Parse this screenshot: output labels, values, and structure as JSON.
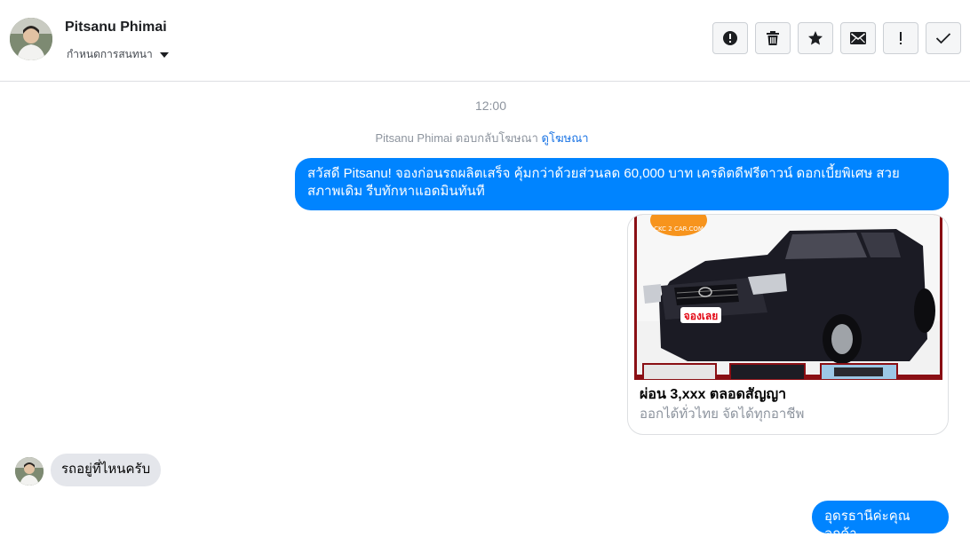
{
  "header": {
    "contact_name": "Pitsanu Phimai",
    "assign_label": "กำหนดการสนทนา",
    "actions": [
      {
        "name": "report-spam-button",
        "icon": "alert-circle-icon"
      },
      {
        "name": "delete-button",
        "icon": "trash-icon"
      },
      {
        "name": "star-button",
        "icon": "star-icon"
      },
      {
        "name": "mark-unread-button",
        "icon": "envelope-icon"
      },
      {
        "name": "follow-up-button",
        "icon": "exclamation-icon"
      },
      {
        "name": "mark-done-button",
        "icon": "check-icon"
      }
    ]
  },
  "conversation": {
    "timestamp": "12:00",
    "reply_note": {
      "name": "Pitsanu Phimai",
      "text": " ตอบกลับโฆษณา ",
      "link": "ดูโฆษณา"
    },
    "messages": {
      "outgoing_1": "สวัสดี Pitsanu! จองก่อนรถผลิตเสร็จ คุ้มกว่าด้วยส่วนลด 60,000 บาท เครดิตดีฟรีดาวน์ ดอกเบี้ยพิเศษ สวย สภาพเดิม รีบทักหาแอดมินทันที",
      "ad_card": {
        "image_desc": "black-pickup-truck-image",
        "logo_text": "CKC 2 CAR.COM",
        "badge_text": "จองเลย",
        "title": "ผ่อน 3,xxx ตลอดสัญญา",
        "subtitle": "ออกได้ทั่วไทย จัดได้ทุกอาชีพ"
      },
      "incoming_1": "รถอยู่ที่ไหนครับ",
      "outgoing_2": "อุดรธานีค่ะคุณลูกค้า"
    }
  },
  "colors": {
    "outgoing_bubble": "#0084ff",
    "incoming_bubble": "#e4e6eb",
    "link": "#1b74e4",
    "muted_text": "#8d949e"
  }
}
